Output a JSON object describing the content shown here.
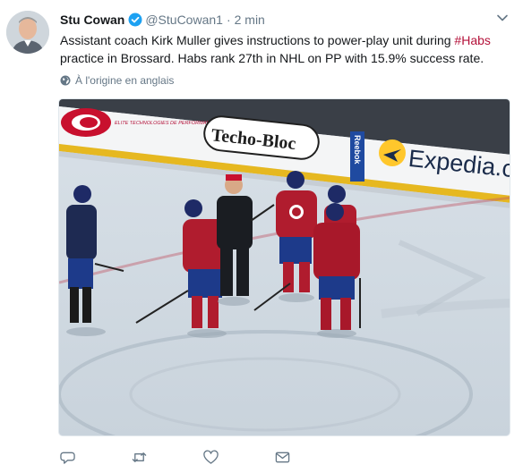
{
  "author": {
    "name": "Stu Cowan",
    "handle": "@StuCowan1",
    "separator": "·",
    "time": "2 min"
  },
  "tweet": {
    "text_part1": "Assistant coach Kirk Muller gives instructions to power-play unit during ",
    "hashtag": "#Habs",
    "text_part2": " practice in Brossard. Habs rank 27th in NHL on PP with 15.9% success rate."
  },
  "translate_label": "À l'origine en anglais",
  "media": {
    "board_ad_1": "ELITE TECHNOLOGIES DE PERFORMANCE POUR LAMES",
    "board_ad_2": "Techo-Bloc",
    "board_ad_3": "Reebok",
    "board_ad_4": "Expedia.ca"
  },
  "icons": {
    "verified": "verified-icon",
    "caret": "chevron-down-icon",
    "globe": "globe-icon",
    "reply": "reply-icon",
    "retweet": "retweet-icon",
    "like": "heart-icon",
    "message": "envelope-icon"
  },
  "colors": {
    "hashtag": "#b4123a",
    "verified": "#1da1f2",
    "secondary_text": "#657786"
  }
}
